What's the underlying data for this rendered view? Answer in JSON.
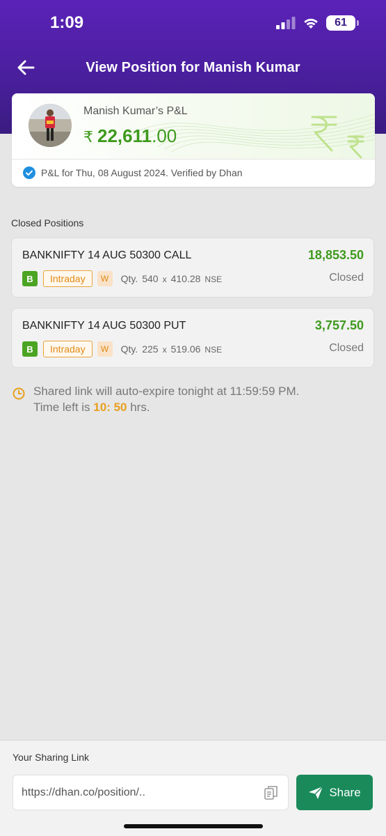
{
  "status_bar": {
    "time": "1:09",
    "battery": "61"
  },
  "nav": {
    "title": "View Position for Manish Kumar"
  },
  "pnl_card": {
    "name": "Manish Kumar’s P&L",
    "currency": "₹",
    "amount_int": "22,611",
    "amount_dec": ".00",
    "verified_text": "P&L for Thu, 08 August 2024. Verified by Dhan"
  },
  "closed_positions": {
    "title": "Closed Positions",
    "items": [
      {
        "name": "BANKNIFTY 14 AUG 50300 CALL",
        "pnl": "18,853.50",
        "status": "Closed",
        "side": "B",
        "product": "Intraday",
        "expiry_tag": "W",
        "qty_label": "Qty.",
        "qty": "540",
        "x": "x",
        "price": "410.28",
        "exchange": "NSE"
      },
      {
        "name": "BANKNIFTY 14 AUG 50300 PUT",
        "pnl": "3,757.50",
        "status": "Closed",
        "side": "B",
        "product": "Intraday",
        "expiry_tag": "W",
        "qty_label": "Qty.",
        "qty": "225",
        "x": "x",
        "price": "519.06",
        "exchange": "NSE"
      }
    ]
  },
  "expire_notice": {
    "line1": "Shared link will auto-expire tonight at 11:59:59 PM.",
    "time_left_prefix": "Time left is",
    "time_left_value": "10: 50",
    "time_left_suffix": "hrs."
  },
  "sharing": {
    "title": "Your Sharing Link",
    "link_value": "https://dhan.co/position/..",
    "share_label": "Share"
  },
  "colors": {
    "header": "#4a1f9e",
    "profit": "#3f9a1e",
    "accent": "#e08a14",
    "share": "#1a8a5a"
  }
}
